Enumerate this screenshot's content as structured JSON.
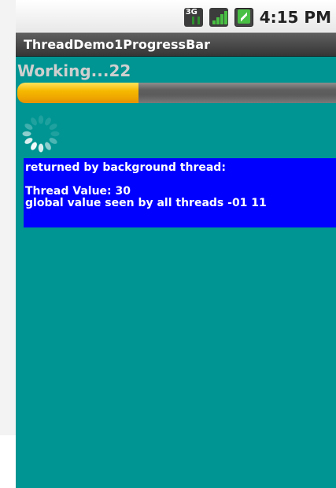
{
  "status_bar": {
    "network_label": "3G",
    "time": "4:15 PM",
    "icons": [
      "3g-data-icon",
      "signal-strength-icon",
      "battery-charging-icon"
    ]
  },
  "title_bar": {
    "title": "ThreadDemo1ProgressBar"
  },
  "main": {
    "working_label": "Working...22",
    "progress_percent": 38,
    "spinner_icon": "loading-spinner-icon"
  },
  "message": {
    "line1": "returned by background thread:",
    "line2": "",
    "line3": "Thread Value: 30",
    "line4": "global value seen by all threads -01 11"
  },
  "colors": {
    "app_background": "#009592",
    "message_background": "#0000ff",
    "progress_fill": "#f5b900",
    "progress_track": "#5f5f5f"
  }
}
